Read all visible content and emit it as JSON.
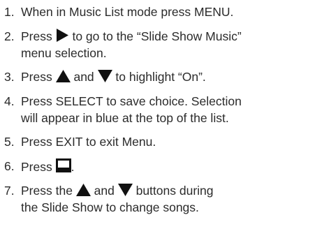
{
  "steps": [
    {
      "number": "1.",
      "text": "When in Music List mode press MENU."
    },
    {
      "number": "2.",
      "before": "Press ",
      "icon": "play-right-arrow",
      "after": " to go to the “Slide Show Music”",
      "line2": "menu selection."
    },
    {
      "number": "3.",
      "before": "Press ",
      "icon1": "up-triangle",
      "middle": " and ",
      "icon2": "down-triangle",
      "after": " to highlight “On”."
    },
    {
      "number": "4.",
      "line1": "Press SELECT to save choice. Selection",
      "line2": "will appear in blue at the top of the list."
    },
    {
      "number": "5.",
      "text": "Press EXIT to exit Menu."
    },
    {
      "number": "6.",
      "before": "Press ",
      "icon": "slideshow-screen",
      "after": "."
    },
    {
      "number": "7.",
      "before": "Press the ",
      "icon1": "up-triangle",
      "middle": " and ",
      "icon2": "down-triangle",
      "after": " buttons during",
      "line2": "the Slide Show to change songs."
    }
  ]
}
